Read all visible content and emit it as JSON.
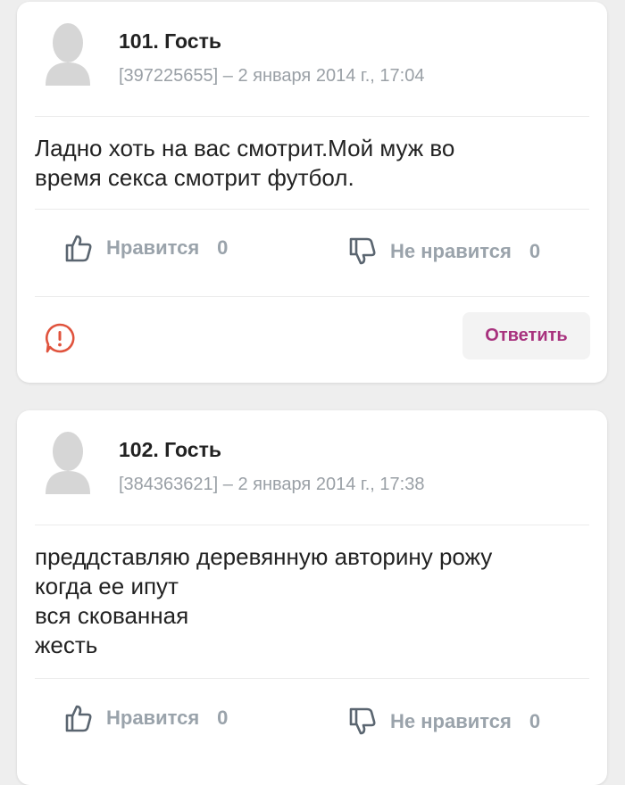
{
  "comments": [
    {
      "author": "101. Гость",
      "meta": "[397225655] – 2 января 2014 г., 17:04",
      "lines": [
        "Ладно хоть на вас смотрит.Мой муж во",
        "время секса смотрит футбол."
      ],
      "like_label": "Нравится",
      "like_count": "0",
      "dislike_label": "Не нравится",
      "dislike_count": "0",
      "reply_label": "Ответить"
    },
    {
      "author": "102. Гость",
      "meta": "[384363621] – 2 января 2014 г., 17:38",
      "lines": [
        "преддставляю деревянную авторину рожу",
        "когда ее ипут",
        "вся скованная",
        "жесть"
      ],
      "like_label": "Нравится",
      "like_count": "0",
      "dislike_label": "Не нравится",
      "dislike_count": "0"
    }
  ],
  "colors": {
    "reply_text": "#a8327e",
    "report_icon": "#e0533d",
    "muted": "#9aa3ab"
  }
}
